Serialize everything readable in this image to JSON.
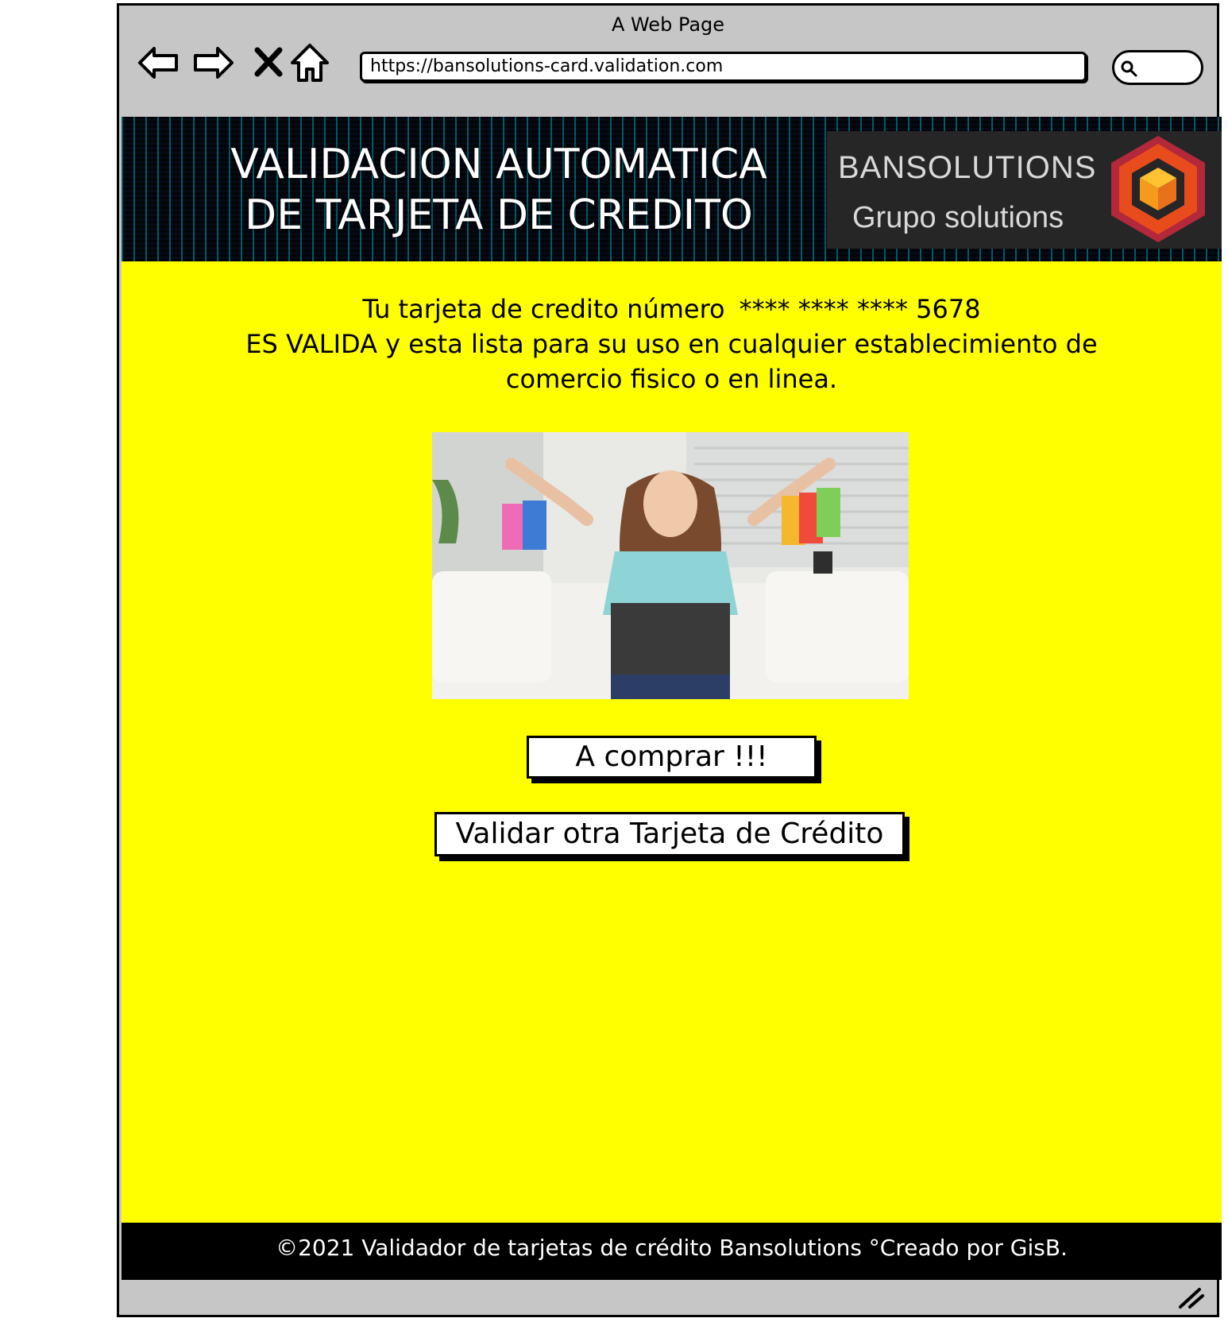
{
  "window": {
    "title": "A Web Page",
    "url": "https://bansolutions-card.validation.com"
  },
  "header": {
    "title_line1": "VALIDACION AUTOMATICA",
    "title_line2": "DE TARJETA DE CREDITO",
    "brand_name": "BANSOLUTIONS",
    "brand_tagline": "Grupo solutions"
  },
  "main": {
    "message_line1": "Tu tarjeta de credito número",
    "card_number": "**** **** **** 5678",
    "message_line2": "ES VALIDA y esta lista para su uso en cualquier establecimiento de",
    "message_line3": "comercio fisico o en linea.",
    "buy_button": "A comprar !!!",
    "validate_button": "Validar otra Tarjeta de Crédito"
  },
  "footer": {
    "text": "©2021 Validador de tarjetas de crédito Bansolutions °Creado por GisB."
  },
  "colors": {
    "content_bg": "#ffff00",
    "footer_bg": "#000000",
    "chrome_bg": "#c6c6c6",
    "brand_box_bg": "#262626"
  }
}
